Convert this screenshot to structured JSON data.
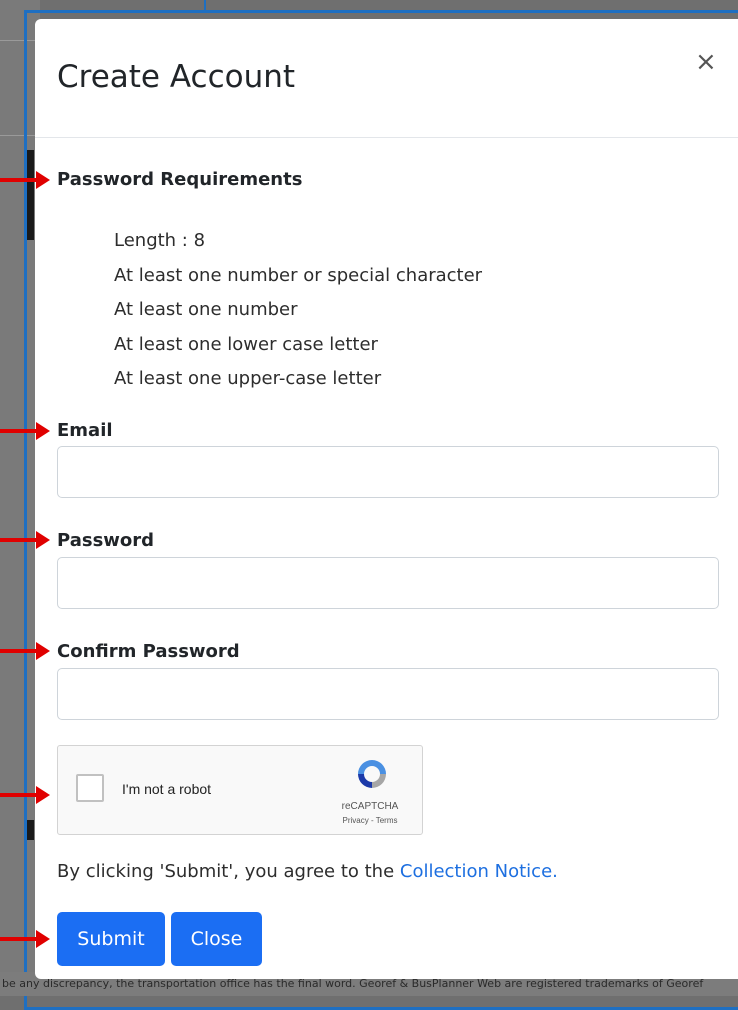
{
  "modal": {
    "title": "Create Account",
    "close_symbol": "×",
    "password_requirements": {
      "heading": "Password Requirements",
      "items": [
        "Length : 8",
        "At least one number or special character",
        "At least one number",
        "At least one lower case letter",
        "At least one upper-case letter"
      ]
    },
    "fields": {
      "email_label": "Email",
      "email_value": "",
      "password_label": "Password",
      "password_value": "",
      "confirm_label": "Confirm Password",
      "confirm_value": ""
    },
    "recaptcha": {
      "checkbox_label": "I'm not a robot",
      "brand": "reCAPTCHA",
      "links": "Privacy - Terms",
      "icon": "recaptcha-logo-icon"
    },
    "notice": {
      "text": "By clicking 'Submit', you agree to the ",
      "link": "Collection Notice."
    },
    "buttons": {
      "submit": "Submit",
      "close": "Close"
    }
  },
  "background": {
    "footer_text": "be any discrepancy, the transportation office has the final word. Georef & BusPlanner Web are registered trademarks of Georef"
  },
  "colors": {
    "accent": "#1b6ef3",
    "annotation_arrow": "#e00000",
    "outline": "#1e6fc2"
  }
}
